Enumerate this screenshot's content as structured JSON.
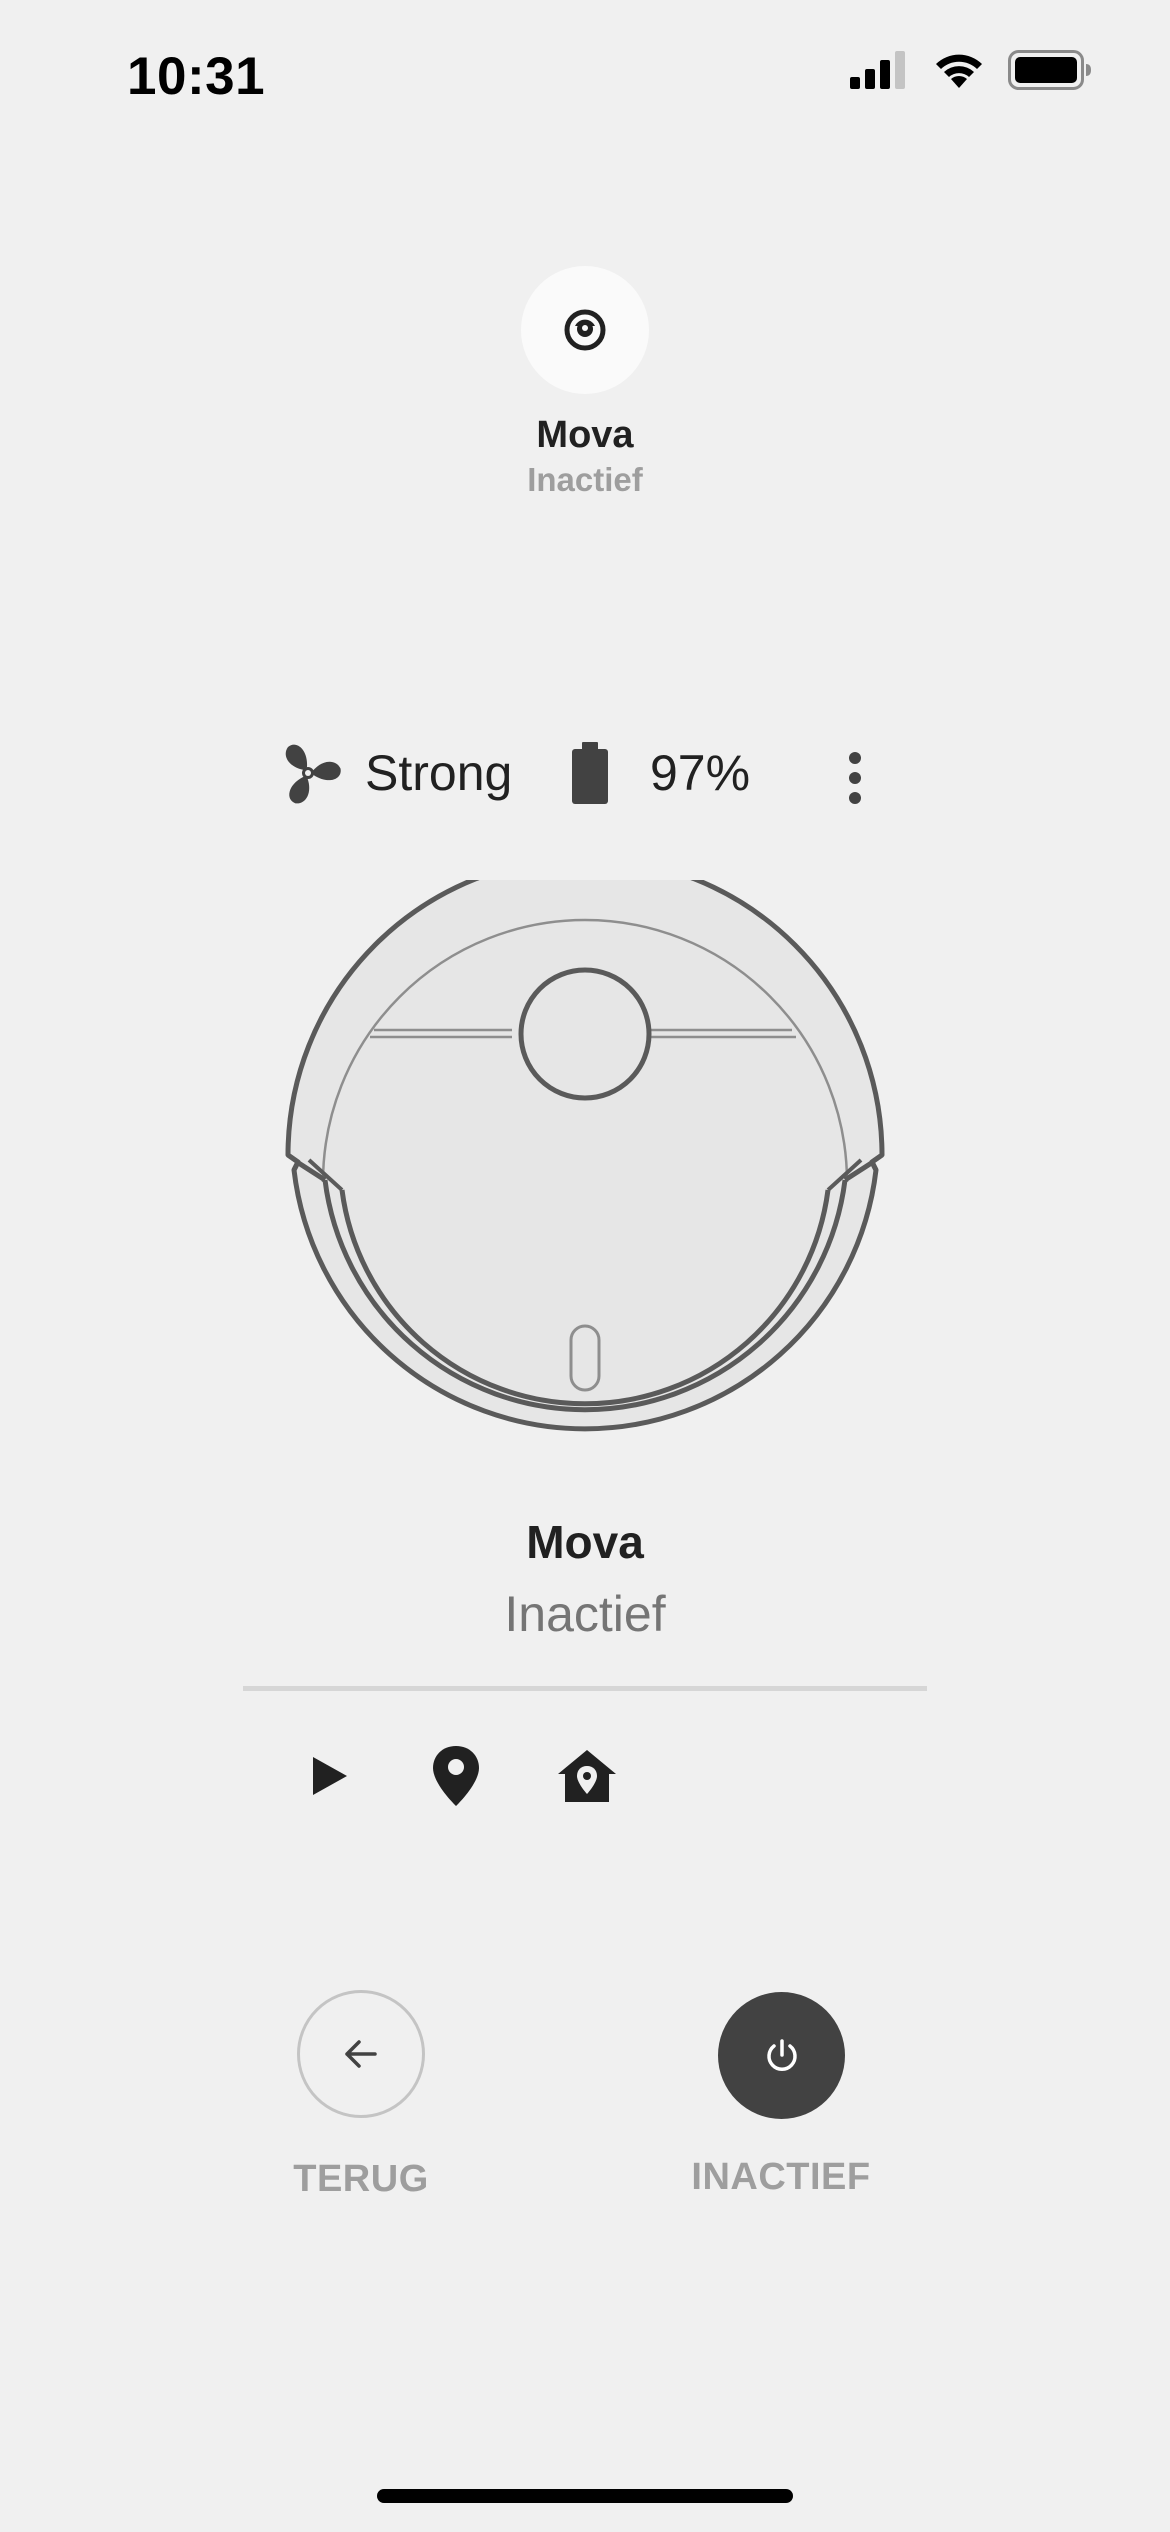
{
  "status_bar": {
    "time": "10:31",
    "icons": [
      "cellular-signal-icon",
      "wifi-icon",
      "battery-icon"
    ]
  },
  "header": {
    "device_name": "Mova",
    "device_state": "Inactief",
    "avatar_icon": "robot-vacuum-icon"
  },
  "info": {
    "fan_icon": "fan-icon",
    "fan_speed": "Strong",
    "battery_icon": "battery-icon",
    "battery_level": "97%",
    "battery_fraction": 0.97,
    "menu_icon": "more-vertical-icon"
  },
  "robot": {
    "name": "Mova",
    "state": "Inactief"
  },
  "actions": [
    {
      "icon": "play-icon"
    },
    {
      "icon": "location-pin-icon"
    },
    {
      "icon": "home-pin-icon"
    }
  ],
  "buttons": {
    "back_label": "TERUG",
    "back_icon": "arrow-left-icon",
    "power_label": "INACTIEF",
    "power_icon": "power-icon"
  },
  "colors": {
    "background": "#f0f0f0",
    "primary_text": "#212121",
    "secondary_text": "#9e9e9e",
    "power_button": "#424242"
  }
}
